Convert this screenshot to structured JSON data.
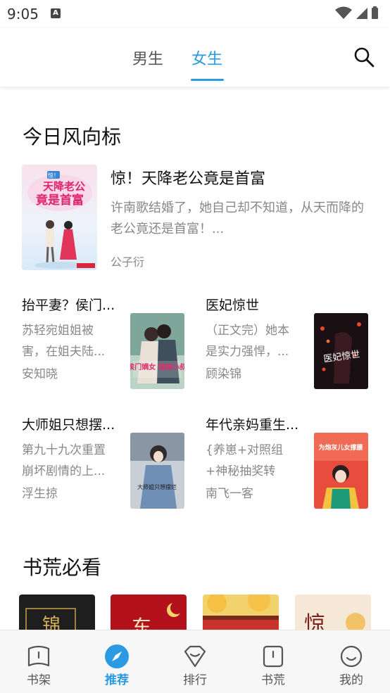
{
  "status_bar": {
    "time": "9:05",
    "notification_letter": "A"
  },
  "top_nav": {
    "tabs": [
      {
        "label": "男生"
      },
      {
        "label": "女生"
      }
    ],
    "active_tab": "女生"
  },
  "colors": {
    "accent": "#2a9be3",
    "text_gray": "#888888"
  },
  "section_trending": {
    "title": "今日风向标",
    "featured": {
      "title": "惊！天降老公竟是首富",
      "description": "许南歌结婚了，她自己却不知道，从天而降的老公竟还是首富！...",
      "author": "公子衍",
      "cover_text_line1": "惊！",
      "cover_text_line2": "天降老公",
      "cover_text_line3": "竟是首富"
    },
    "books": [
      {
        "title": "抬平妻？侯门...",
        "description": "苏轻宛姐姐被害，在姐夫陆...",
        "author": "安知晓",
        "cover_text": "侯门嫡女 强嫁小叔"
      },
      {
        "title": "医妃惊世",
        "description": "（正文完）她本是实力强悍，...",
        "author": "顾染锦",
        "cover_text": "医妃惊世"
      },
      {
        "title": "大师姐只想摆...",
        "description": "第九十九次重置崩坏剧情的上...",
        "author": "浮生掠",
        "cover_text": "大师姐只想摆烂"
      },
      {
        "title": "年代亲妈重生...",
        "description": "{养崽+对照组+神秘抽奖转盘...",
        "author": "南飞一客",
        "cover_text": "为炮灰儿女撑腰"
      }
    ]
  },
  "section_must_read": {
    "title": "书荒必看",
    "covers": [
      {
        "cover_text": "锦"
      },
      {
        "cover_text": "东"
      },
      {
        "cover_text": ""
      },
      {
        "cover_text": "惊"
      }
    ]
  },
  "bottom_nav": {
    "items": [
      {
        "label": "书架",
        "icon": "bookshelf-icon"
      },
      {
        "label": "推荐",
        "icon": "compass-icon"
      },
      {
        "label": "排行",
        "icon": "ranking-icon"
      },
      {
        "label": "书荒",
        "icon": "book-icon"
      },
      {
        "label": "我的",
        "icon": "profile-icon"
      }
    ],
    "active": "推荐"
  }
}
